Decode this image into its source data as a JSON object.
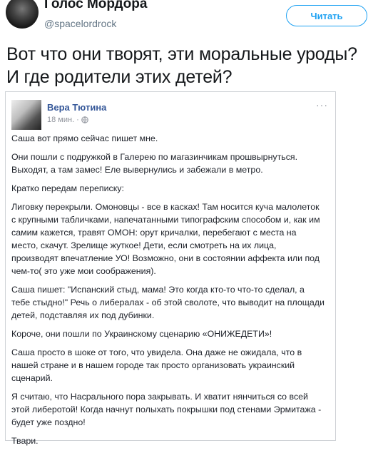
{
  "tweet": {
    "display_name": "Голос Мордора",
    "handle": "@spacelordrock",
    "follow_label": "Читать",
    "text": "Вот что они творят, эти моральные уроды?\nИ где родители этих детей?"
  },
  "fb_post": {
    "author": "Вера Тютина",
    "time": "18 мин. ·",
    "menu_glyph": "···",
    "paragraphs": [
      "Саша вот прямо сейчас пишет мне.",
      "Они пошли с подружкой в Галерею по магазинчикам прошвырнуться. Выходят, а там замес! Еле вывернулись и забежали в метро.",
      "Кратко передам переписку:",
      "Лиговку перекрыли. Омоновцы - все в касках! Там носится куча малолеток с крупными табличками, напечатанными типографским способом и, как им самим кажется, травят ОМОН: орут кричалки, перебегают с места на место, скачут. Зрелище жуткое! Дети, если смотреть на их лица, производят впечатление УО! Возможно, они в состоянии аффекта или под чем-то( это уже мои соображения).",
      "Саша пишет: \"Испанский стыд, мама! Это когда кто-то что-то сделал, а тебе стыдно!\" Речь о либералах - об этой сволоте, что выводит на площади детей, подставляя их под дубинки.",
      "Короче, они пошли по Украинскому сценарию «ОНИЖЕДЕТИ»!",
      "Саша просто в шоке от того, что увидела. Она даже не ожидала, что в нашей стране и в нашем городе так просто организовать украинский сценарий.",
      "Я считаю, что Насрального пора закрывать. И хватит нянчиться со всей этой либеротой! Когда начнут полыхать покрышки под стенами Эрмитажа - будет уже поздно!",
      "Твари."
    ]
  },
  "colors": {
    "accent": "#1da1f2",
    "fb_name": "#365899",
    "muted": "#657786"
  }
}
